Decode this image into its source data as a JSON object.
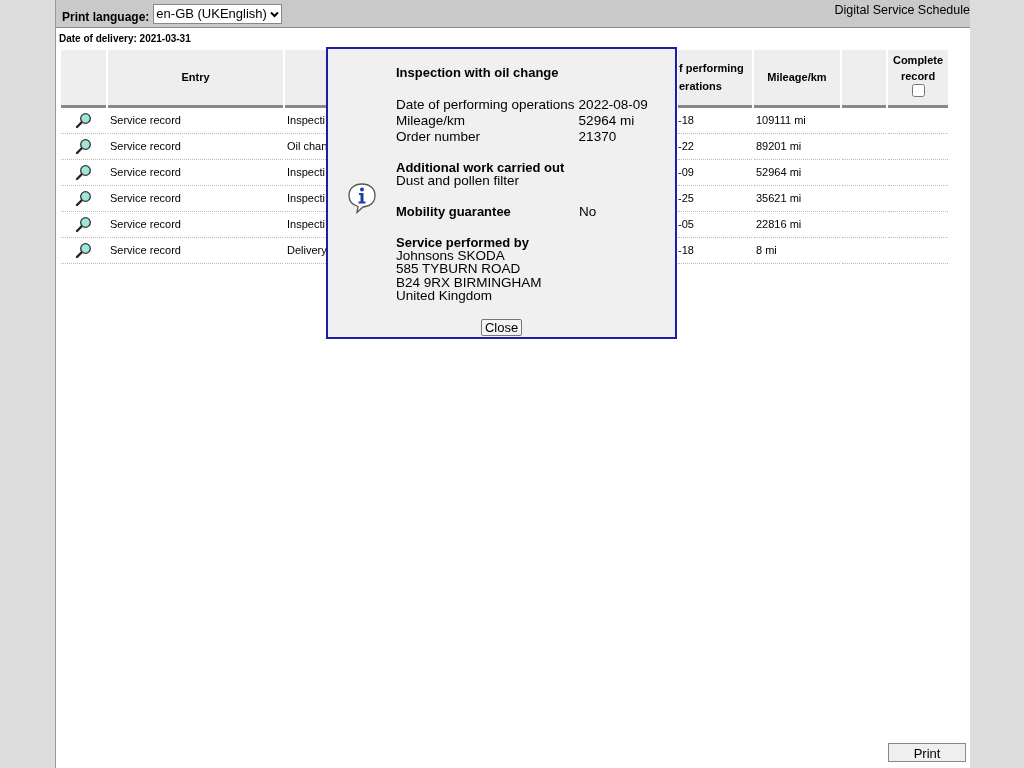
{
  "header": {
    "language_label": "Print language:",
    "language_value": "en-GB (UKEnglish)",
    "title": "Digital Service Schedule"
  },
  "delivery_date": "Date of delivery: 2021-03-31",
  "table": {
    "columns": [
      {
        "kind": "blank"
      },
      {
        "kind": "text",
        "lines": [
          "Entry"
        ]
      },
      {
        "kind": "blank"
      },
      {
        "kind": "text",
        "lines": [
          "f performing",
          "erations"
        ]
      },
      {
        "kind": "text",
        "lines": [
          "Mileage/km"
        ]
      },
      {
        "kind": "blank"
      },
      {
        "kind": "check",
        "lines": [
          "Complete",
          "record"
        ],
        "checked": false
      }
    ],
    "rows": [
      {
        "entry": "Service record",
        "type": "Inspecti",
        "date": "-18",
        "mileage": "109111 mi"
      },
      {
        "entry": "Service record",
        "type": "Oil chan",
        "date": "-22",
        "mileage": "89201 mi"
      },
      {
        "entry": "Service record",
        "type": "Inspecti",
        "date": "-09",
        "mileage": "52964 mi"
      },
      {
        "entry": "Service record",
        "type": "Inspecti",
        "date": "-25",
        "mileage": "35621 mi"
      },
      {
        "entry": "Service record",
        "type": "Inspecti",
        "date": "-05",
        "mileage": "22816 mi"
      },
      {
        "entry": "Service record",
        "type": "Delivery",
        "date": "-18",
        "mileage": "8 mi"
      }
    ]
  },
  "dialog": {
    "title": "Inspection with oil change",
    "details": [
      {
        "label": "Date of performing operations",
        "value": "2022-08-09"
      },
      {
        "label": "Mileage/km",
        "value": "52964 mi"
      },
      {
        "label": "Order number",
        "value": "21370"
      }
    ],
    "additional_heading": "Additional work carried out",
    "additional_text": "Dust and pollen filter",
    "mobility_label": "Mobility guarantee",
    "mobility_value": "No",
    "performed_heading": "Service performed by",
    "address": [
      "Johnsons SKODA",
      "585 TYBURN ROAD",
      "B24 9RX BIRMINGHAM",
      "United Kingdom"
    ],
    "close_button": "Close"
  },
  "print_button": "Print"
}
